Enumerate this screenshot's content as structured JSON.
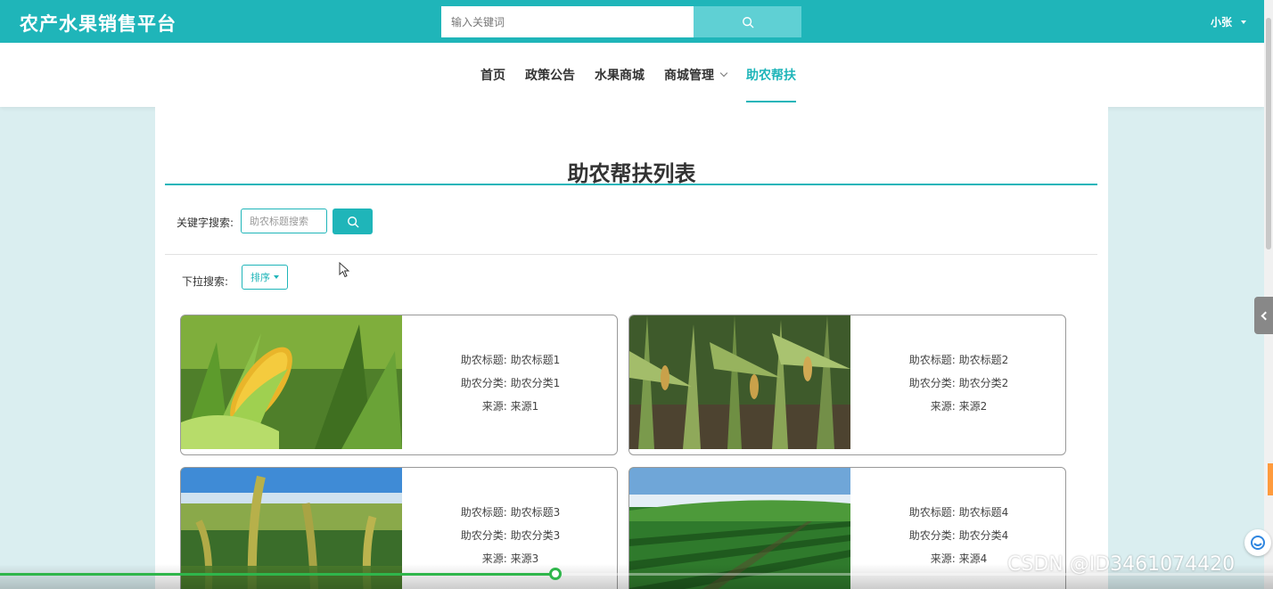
{
  "header": {
    "logo": "农产水果销售平台",
    "search_placeholder": "输入关键词",
    "user_name": "小张"
  },
  "nav": {
    "items": [
      {
        "label": "首页"
      },
      {
        "label": "政策公告"
      },
      {
        "label": "水果商城"
      },
      {
        "label": "商城管理",
        "has_dropdown": true
      },
      {
        "label": "助农帮扶",
        "active": true
      }
    ]
  },
  "page": {
    "title": "助农帮扶列表",
    "keyword_label": "关键字搜索:",
    "keyword_placeholder": "助农标题搜索",
    "dropdown_label": "下拉搜索:",
    "sort_label": "排序"
  },
  "cards": [
    {
      "title_label": "助农标题",
      "title": "助农标题1",
      "category_label": "助农分类",
      "category": "助农分类1",
      "source_label": "来源",
      "source": "来源1",
      "image": "corn-ear-photo"
    },
    {
      "title_label": "助农标题",
      "title": "助农标题2",
      "category_label": "助农分类",
      "category": "助农分类2",
      "source_label": "来源",
      "source": "来源2",
      "image": "corn-field-photo"
    },
    {
      "title_label": "助农标题",
      "title": "助农标题3",
      "category_label": "助农分类",
      "category": "助农分类3",
      "source_label": "来源",
      "source": "来源3",
      "image": "millet-field-photo"
    },
    {
      "title_label": "助农标题",
      "title": "助农标题4",
      "category_label": "助农分类",
      "category": "助农分类4",
      "source_label": "来源",
      "source": "来源4",
      "image": "green-crop-field-photo"
    }
  ],
  "player": {
    "progress": 0.436
  },
  "watermark": "CSDN @ID3461074420",
  "colors": {
    "accent": "#1fb5b9",
    "progress": "#2fb64b",
    "page_background": "#daeef0"
  }
}
